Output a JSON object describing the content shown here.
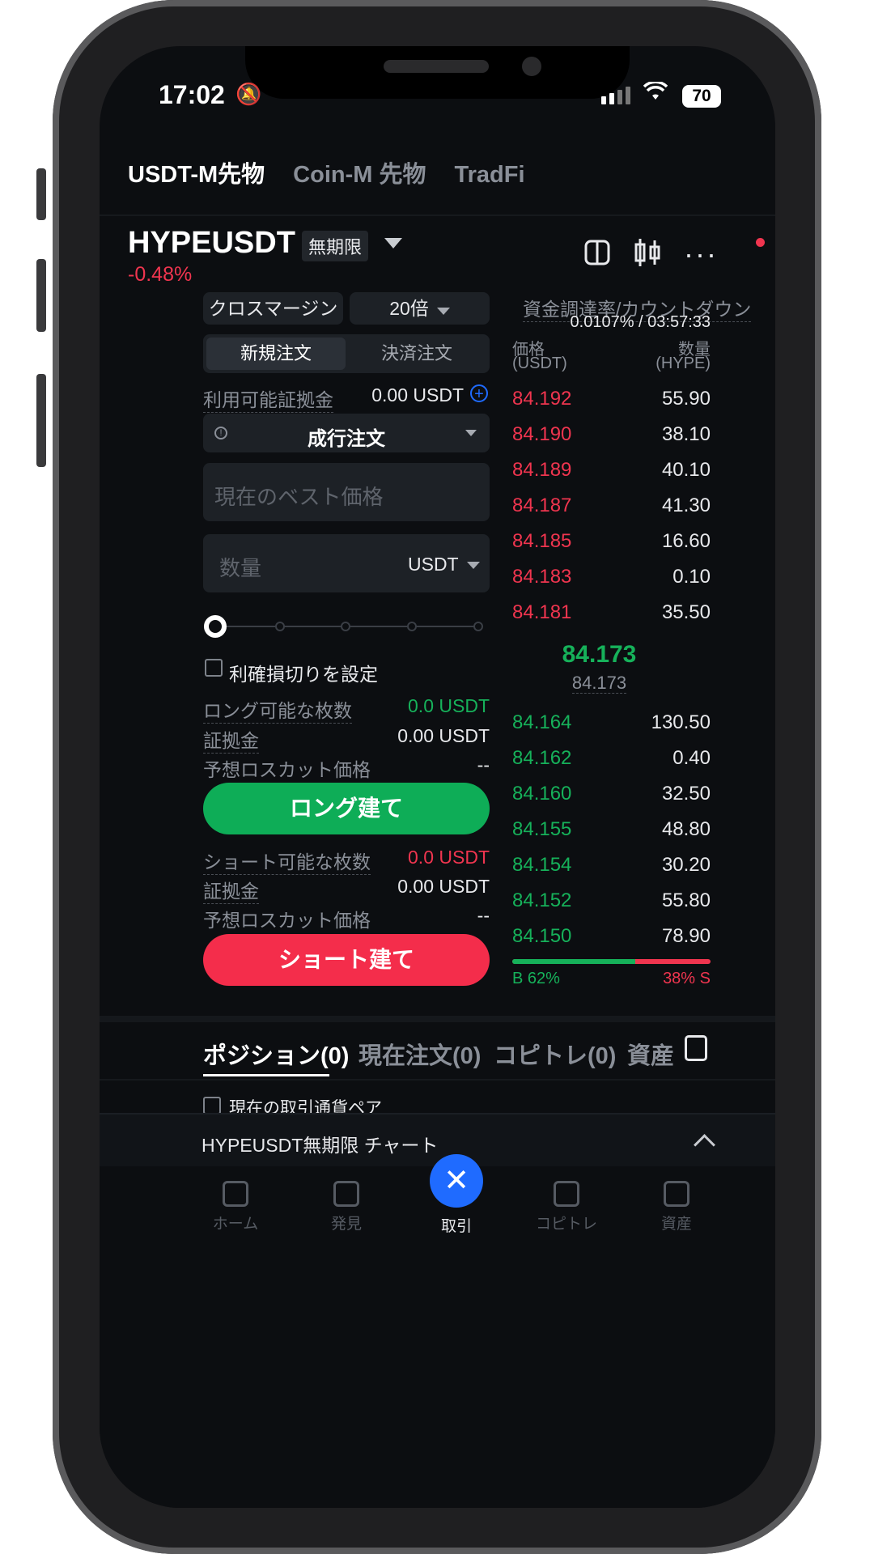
{
  "status": {
    "time": "17:02",
    "battery": "70"
  },
  "top_tabs": [
    "USDT-M先物",
    "Coin-M 先物",
    "TradFi"
  ],
  "pair": {
    "symbol": "HYPEUSDT",
    "tag": "無期限",
    "change": "-0.48%"
  },
  "controls": {
    "margin_mode": "クロスマージン",
    "leverage": "20倍",
    "order_tabs": [
      "新規注文",
      "決済注文"
    ],
    "available_label": "利用可能証拠金",
    "available_value": "0.00 USDT",
    "order_type": "成行注文",
    "price_placeholder": "現在のベスト価格",
    "qty_placeholder": "数量",
    "qty_unit": "USDT",
    "tpsl_label": "利確損切りを設定",
    "slider_percent": 0
  },
  "long": {
    "max_label": "ロング可能な枚数",
    "max_value": "0.0 USDT",
    "margin_label": "証拠金",
    "margin_value": "0.00 USDT",
    "liq_label": "予想ロスカット価格",
    "liq_value": "--",
    "button": "ロング建て"
  },
  "short": {
    "max_label": "ショート可能な枚数",
    "max_value": "0.0 USDT",
    "margin_label": "証拠金",
    "margin_value": "0.00 USDT",
    "liq_label": "予想ロスカット価格",
    "liq_value": "--",
    "button": "ショート建て"
  },
  "orderbook": {
    "funding_label": "資金調達率/カウントダウン",
    "funding_value": "0.0107% / 03:57:33",
    "price_header": "価格",
    "price_unit": "(USDT)",
    "qty_header": "数量",
    "qty_unit": "(HYPE)",
    "asks": [
      {
        "price": "84.192",
        "qty": "55.90"
      },
      {
        "price": "84.190",
        "qty": "38.10"
      },
      {
        "price": "84.189",
        "qty": "40.10"
      },
      {
        "price": "84.187",
        "qty": "41.30"
      },
      {
        "price": "84.185",
        "qty": "16.60"
      },
      {
        "price": "84.183",
        "qty": "0.10"
      },
      {
        "price": "84.181",
        "qty": "35.50"
      }
    ],
    "last_price": "84.173",
    "mark_price": "84.173",
    "bids": [
      {
        "price": "84.164",
        "qty": "130.50"
      },
      {
        "price": "84.162",
        "qty": "0.40"
      },
      {
        "price": "84.160",
        "qty": "32.50"
      },
      {
        "price": "84.155",
        "qty": "48.80"
      },
      {
        "price": "84.154",
        "qty": "30.20"
      },
      {
        "price": "84.152",
        "qty": "55.80"
      },
      {
        "price": "84.150",
        "qty": "78.90"
      }
    ],
    "buy_ratio": "B 62%",
    "sell_ratio": "38% S",
    "buy_fraction": 0.62
  },
  "bottom_tabs": [
    "ポジション(0)",
    "現在注文(0)",
    "コピトレ(0)",
    "資産"
  ],
  "current_pair_label": "現在の取引通貨ペア",
  "chart_bar": "HYPEUSDT無期限 チャート",
  "nav": [
    "ホーム",
    "発見",
    "取引",
    "コピトレ",
    "資産"
  ],
  "colors": {
    "green": "#16b15a",
    "red": "#f0354f",
    "accent_blue": "#1f6bff"
  }
}
